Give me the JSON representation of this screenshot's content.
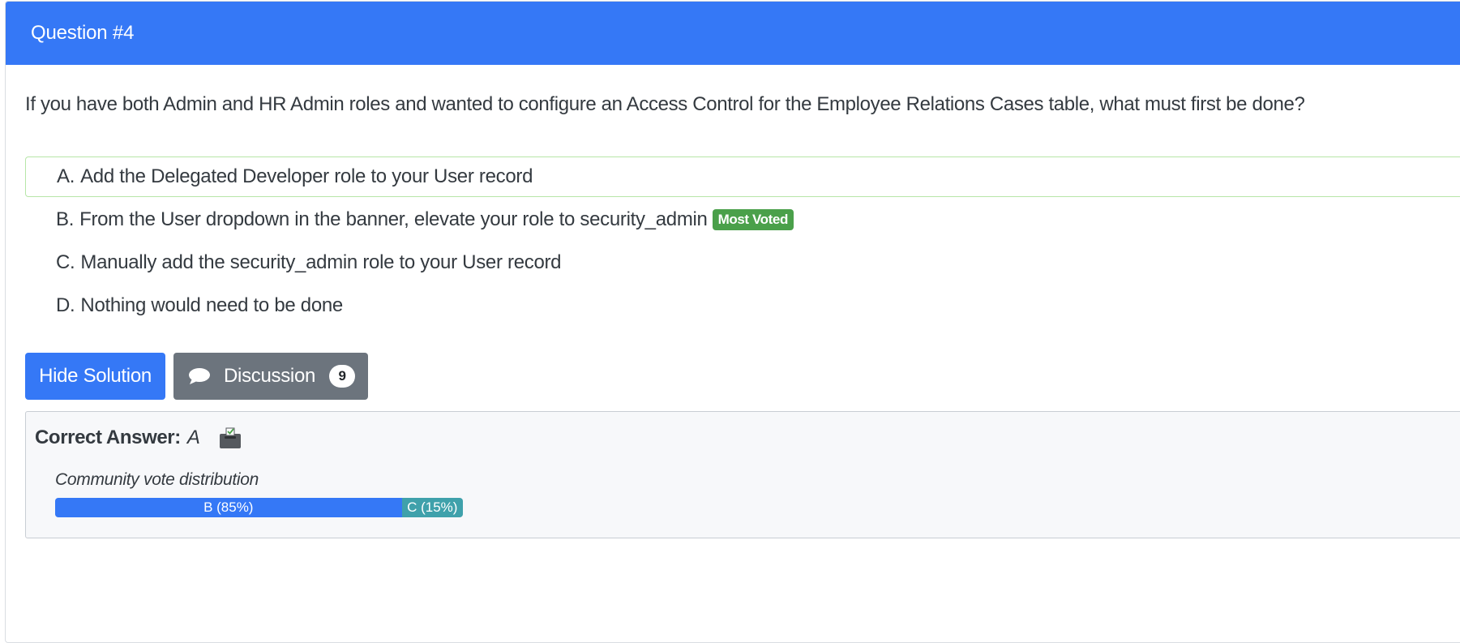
{
  "header": {
    "title": "Question #4"
  },
  "question": {
    "text": "If you have both Admin and HR Admin roles and wanted to configure an Access Control for the Employee Relations Cases table, what must first be done?"
  },
  "choices": [
    {
      "letter": "A.",
      "text": "Add the Delegated Developer role to your User record",
      "highlighted": true
    },
    {
      "letter": "B.",
      "text": "From the User dropdown in the banner, elevate your role to security_admin",
      "badge": "Most Voted"
    },
    {
      "letter": "C.",
      "text": "Manually add the security_admin role to your User record"
    },
    {
      "letter": "D.",
      "text": "Nothing would need to be done"
    }
  ],
  "actions": {
    "hide_solution_label": "Hide Solution",
    "discussion_label": "Discussion",
    "discussion_count": "9"
  },
  "solution": {
    "correct_answer_label": "Correct Answer:",
    "correct_answer_value": "A",
    "vote_title": "Community vote distribution",
    "votes": [
      {
        "label": "B (85%)",
        "percent": 85,
        "color": "#3578f6"
      },
      {
        "label": "C (15%)",
        "percent": 15,
        "color": "#3fa1ab"
      }
    ]
  },
  "colors": {
    "header_bg": "#3578f6",
    "most_voted_badge": "#4aa04a",
    "discussion_button": "#6c747d"
  },
  "icons": {
    "discussion": "comment-icon",
    "correct_answer": "ballot-box-icon"
  }
}
